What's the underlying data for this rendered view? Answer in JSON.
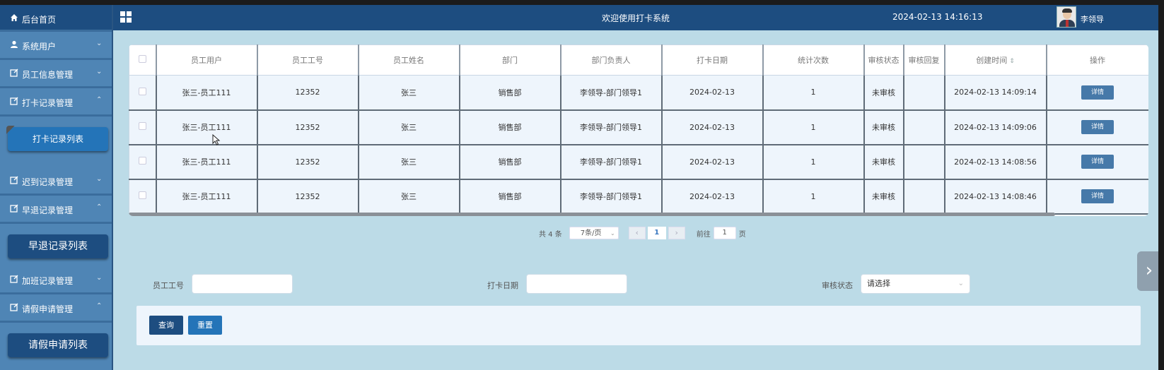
{
  "header": {
    "title": "欢迎使用打卡系统",
    "datetime": "2024-02-13 14:16:13",
    "user": "李领导"
  },
  "sidebar": {
    "home": "后台首页",
    "items": [
      {
        "label": "系统用户",
        "chevron": "⌄"
      },
      {
        "label": "员工信息管理",
        "chevron": "⌄"
      },
      {
        "label": "打卡记录管理",
        "chevron": "⌃"
      },
      {
        "label": "迟到记录管理",
        "chevron": "⌄"
      },
      {
        "label": "早退记录管理",
        "chevron": "⌃"
      },
      {
        "label": "加班记录管理",
        "chevron": "⌄"
      },
      {
        "label": "请假申请管理",
        "chevron": "⌃"
      }
    ],
    "sub_checkin": "打卡记录列表",
    "sub_early": "早退记录列表",
    "sub_leave": "请假申请列表"
  },
  "table": {
    "headers": [
      "员工用户",
      "员工工号",
      "员工姓名",
      "部门",
      "部门负责人",
      "打卡日期",
      "统计次数",
      "审核状态",
      "审核回复",
      "创建时间",
      "操作"
    ],
    "sort_icon": "⇕",
    "detail_label": "详情",
    "rows": [
      [
        "张三-员工111",
        "12352",
        "张三",
        "销售部",
        "李领导-部门领导1",
        "2024-02-13",
        "1",
        "未审核",
        "",
        "2024-02-13 14:09:14"
      ],
      [
        "张三-员工111",
        "12352",
        "张三",
        "销售部",
        "李领导-部门领导1",
        "2024-02-13",
        "1",
        "未审核",
        "",
        "2024-02-13 14:09:06"
      ],
      [
        "张三-员工111",
        "12352",
        "张三",
        "销售部",
        "李领导-部门领导1",
        "2024-02-13",
        "1",
        "未审核",
        "",
        "2024-02-13 14:08:56"
      ],
      [
        "张三-员工111",
        "12352",
        "张三",
        "销售部",
        "李领导-部门领导1",
        "2024-02-13",
        "1",
        "未审核",
        "",
        "2024-02-13 14:08:46"
      ]
    ]
  },
  "pagination": {
    "total": "共 4 条",
    "page_size": "7条/页",
    "prev": "‹",
    "current": "1",
    "next": "›",
    "goto_prefix": "前往",
    "goto_value": "1",
    "goto_suffix": "页"
  },
  "search": {
    "emp_no_label": "员工工号",
    "date_label": "打卡日期",
    "status_label": "审核状态",
    "status_placeholder": "请选择",
    "query_label": "查询",
    "reset_label": "重置"
  },
  "side_arrow": "›",
  "colors": {
    "header_bg": "#1d4d80",
    "sidebar_bg": "#4f85b5",
    "page_bg": "#bcdbe7",
    "button_primary": "#1d4d80",
    "button_secondary": "#2474b8"
  }
}
